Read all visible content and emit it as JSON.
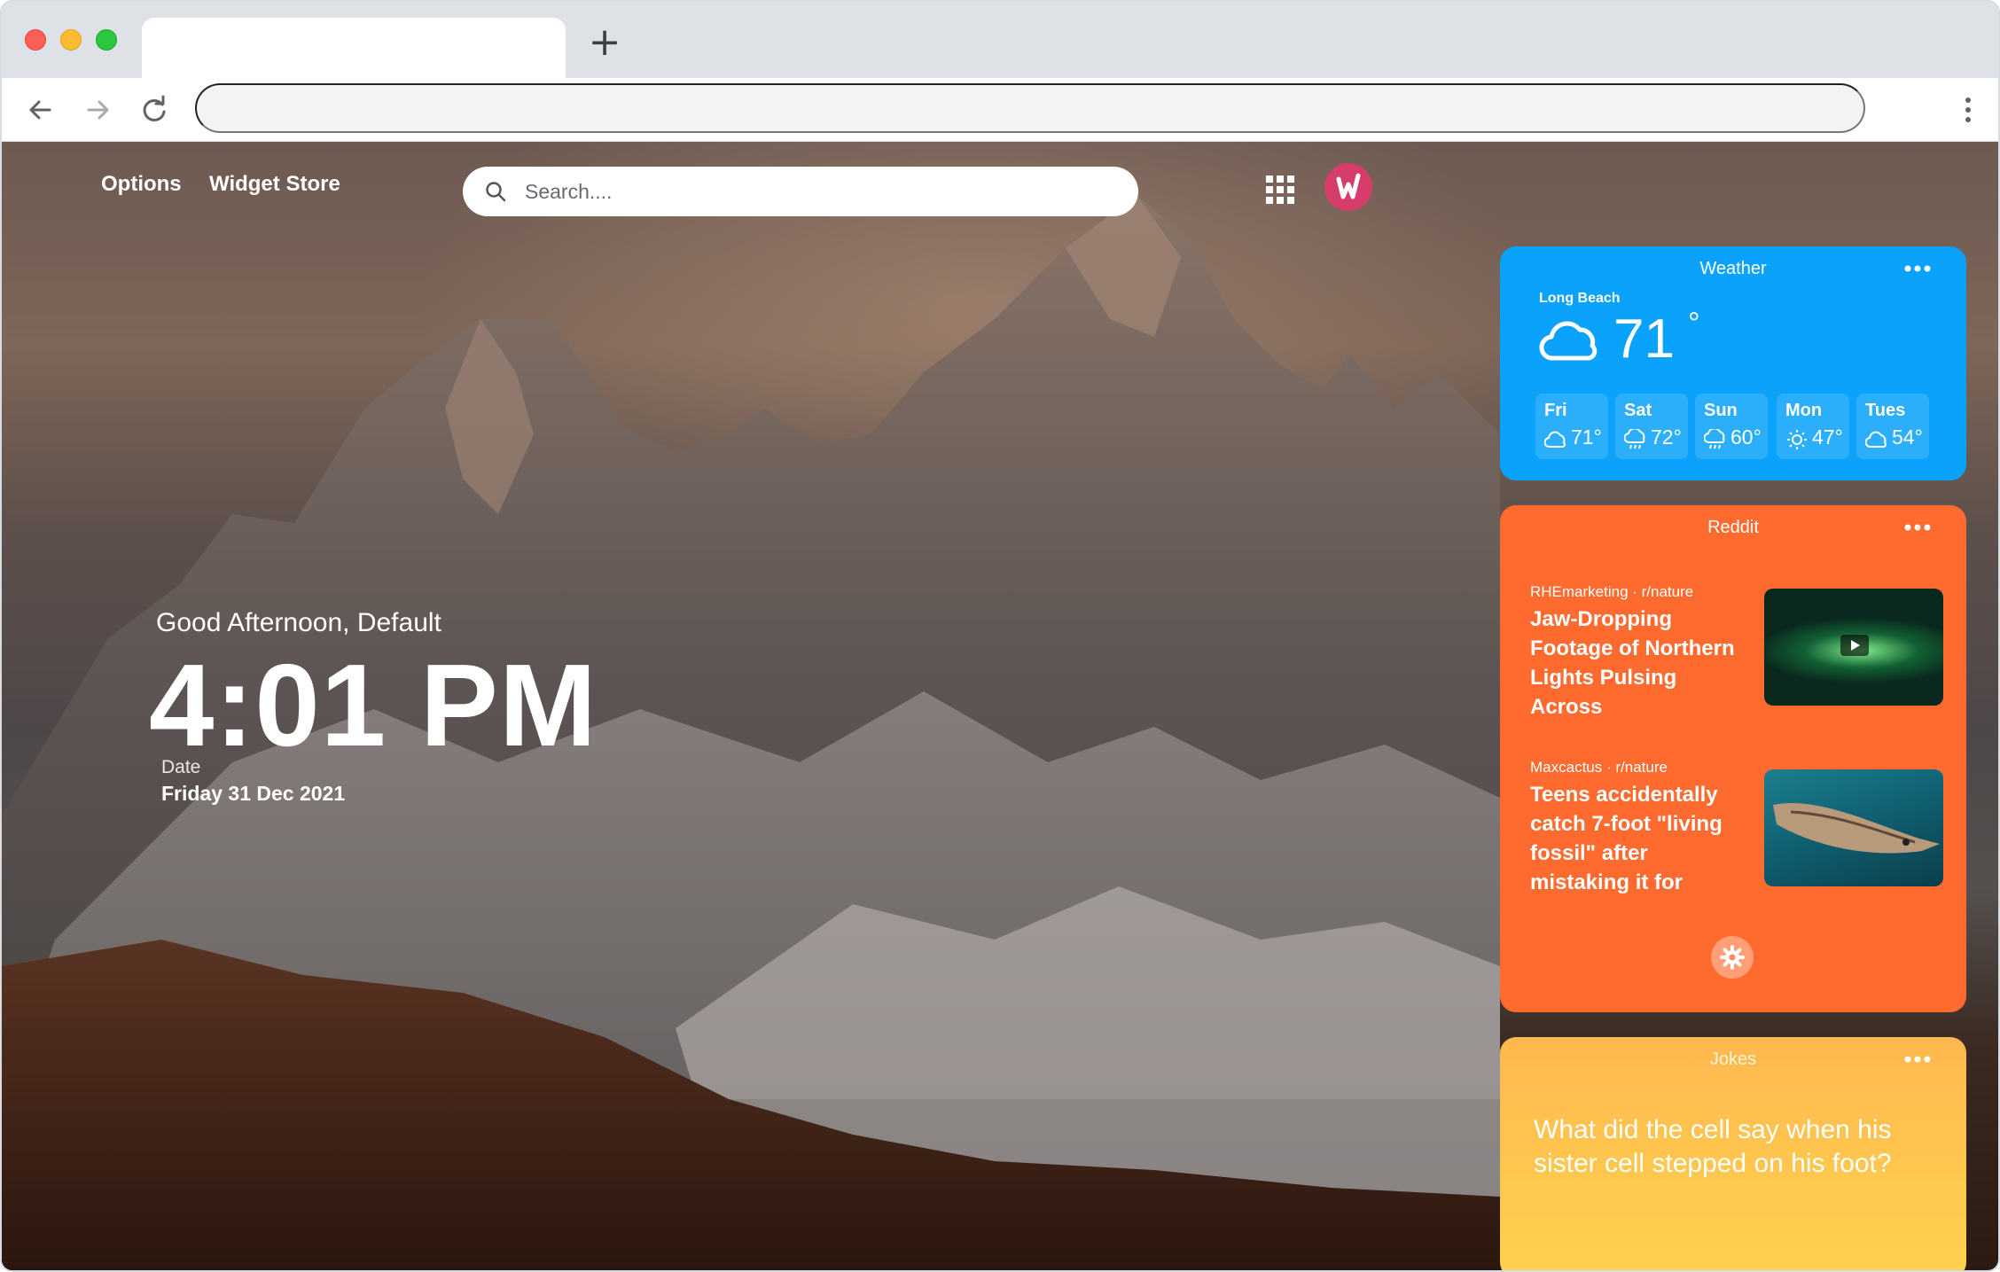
{
  "browser": {
    "new_tab_symbol": "+",
    "address_value": ""
  },
  "header": {
    "options_label": "Options",
    "widget_store_label": "Widget Store",
    "search_placeholder": "Search....",
    "apps_icon": "apps-grid-icon",
    "avatar_icon": "w-logo-avatar"
  },
  "main": {
    "greeting": "Good Afternoon, Default",
    "time": "4:01 PM",
    "date_label": "Date",
    "date_value": "Friday 31 Dec 2021"
  },
  "weather": {
    "title": "Weather",
    "city": "Long Beach",
    "current_temp": "71",
    "degree_symbol": "°",
    "color": "#0aa2fb",
    "forecast": [
      {
        "day": "Fri",
        "temp": "71°",
        "icon": "cloud-icon"
      },
      {
        "day": "Sat",
        "temp": "72°",
        "icon": "rain-cloud-icon"
      },
      {
        "day": "Sun",
        "temp": "60°",
        "icon": "rain-cloud-icon"
      },
      {
        "day": "Mon",
        "temp": "47°",
        "icon": "sun-icon"
      },
      {
        "day": "Tues",
        "temp": "54°",
        "icon": "cloud-icon"
      }
    ]
  },
  "reddit": {
    "title": "Reddit",
    "color": "#ff6a2f",
    "posts": [
      {
        "meta": "RHEmarketing · r/nature",
        "title": "Jaw-Dropping Footage of Northern Lights Pulsing Across"
      },
      {
        "meta": "Maxcactus · r/nature",
        "title": "Teens accidentally catch 7-foot \"living fossil\" after mistaking it for"
      }
    ]
  },
  "jokes": {
    "title": "Jokes",
    "text": "What did the cell say when his sister cell stepped on his foot?"
  }
}
